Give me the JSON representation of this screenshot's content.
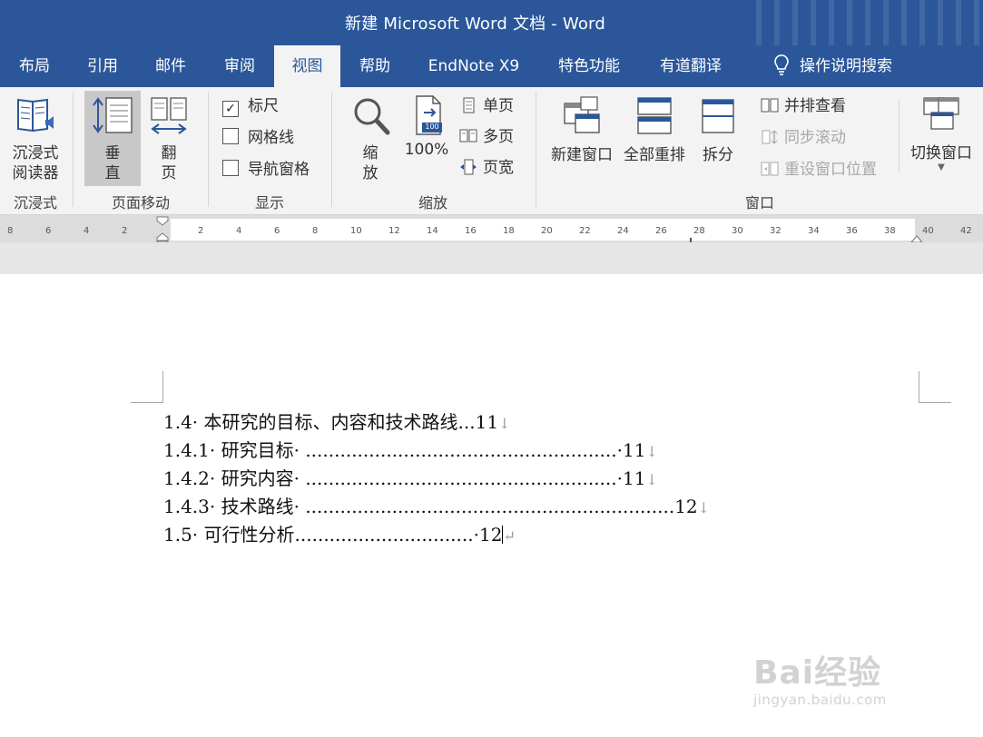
{
  "window": {
    "title": "新建 Microsoft Word 文档  -  Word"
  },
  "tabs": [
    "布局",
    "引用",
    "邮件",
    "审阅",
    "视图",
    "帮助",
    "EndNote X9",
    "特色功能",
    "有道翻译",
    "操作说明搜索"
  ],
  "active_tab": "视图",
  "ribbon": {
    "immersive": {
      "reader_label": "沉浸式\n阅读器",
      "group": "沉浸式"
    },
    "page_movement": {
      "vertical": "垂\n直",
      "flip": "翻\n页",
      "group": "页面移动"
    },
    "show": {
      "ruler": "标尺",
      "ruler_checked": true,
      "gridlines": "网格线",
      "gridlines_checked": false,
      "nav_pane": "导航窗格",
      "nav_pane_checked": false,
      "group": "显示"
    },
    "zoom": {
      "zoom_label": "缩\n放",
      "percent_label": "100%",
      "percent_badge": "100",
      "single_page": "单页",
      "multi_page": "多页",
      "page_width": "页宽",
      "group": "缩放"
    },
    "window": {
      "new_window": "新建窗口",
      "arrange_all": "全部重排",
      "split": "拆分",
      "side_by_side": "并排查看",
      "sync_scroll": "同步滚动",
      "reset_position": "重设窗口位置",
      "switch_window": "切换窗口",
      "group": "窗口"
    }
  },
  "ruler": {
    "left_ticks": [
      "8",
      "6",
      "4",
      "2"
    ],
    "ticks": [
      "2",
      "4",
      "6",
      "8",
      "10",
      "12",
      "14",
      "16",
      "18",
      "20",
      "22",
      "24",
      "26",
      "28",
      "30",
      "32",
      "34",
      "36",
      "38",
      "40",
      "42"
    ]
  },
  "document": {
    "toc": [
      {
        "num": "1.4·",
        "title": "本研究的目标、内容和技术路线",
        "leader": "...",
        "page": "11",
        "mark": "↓"
      },
      {
        "num": "1.4.1·",
        "title": "研究目标·",
        "leader": "......................................................",
        "page": "·11",
        "mark": "↓"
      },
      {
        "num": "1.4.2·",
        "title": "研究内容·",
        "leader": "......................................................",
        "page": "·11",
        "mark": "↓"
      },
      {
        "num": "1.4.3·",
        "title": "技术路线·",
        "leader": "................................................................",
        "page": "12",
        "mark": "↓"
      },
      {
        "num": "1.5·",
        "title": "可行性分析",
        "leader": "...............................",
        "page": "·12",
        "mark": "↵"
      }
    ]
  },
  "watermark": {
    "brand": "Bai经验",
    "url": "jingyan.baidu.com"
  }
}
